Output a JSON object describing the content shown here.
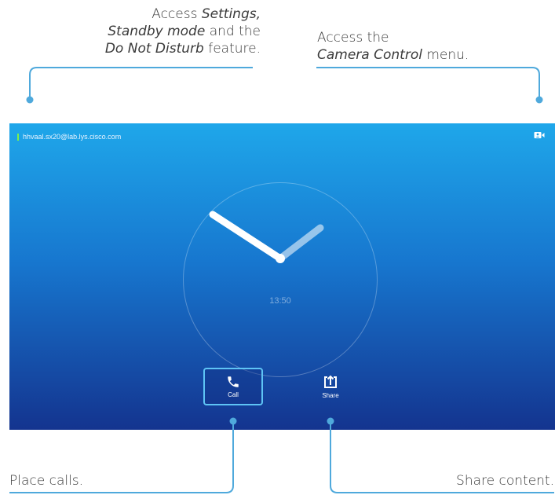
{
  "callouts": {
    "top_left": {
      "line1_prefix": "Access ",
      "line1_em": "Settings,",
      "line2_em": "Standby mode",
      "line2_suffix": " and the",
      "line3_em": "Do Not Disturb",
      "line3_suffix": " feature."
    },
    "top_right": {
      "line1": "Access the",
      "line2_em": "Camera Control",
      "line2_suffix": " menu."
    },
    "bottom_left": "Place calls.",
    "bottom_right": "Share content."
  },
  "screen": {
    "status_user": "hhvaal.sx20@lab.lys.cisco.com",
    "clock_time": "13:50",
    "buttons": {
      "call_label": "Call",
      "share_label": "Share"
    }
  },
  "colors": {
    "status_indicator": "#7df04a",
    "leader_line": "#4fa9dc",
    "call_button_border": "#5ec4f5"
  },
  "icons": [
    "camera-control-icon",
    "phone-icon",
    "share-upload-icon"
  ]
}
